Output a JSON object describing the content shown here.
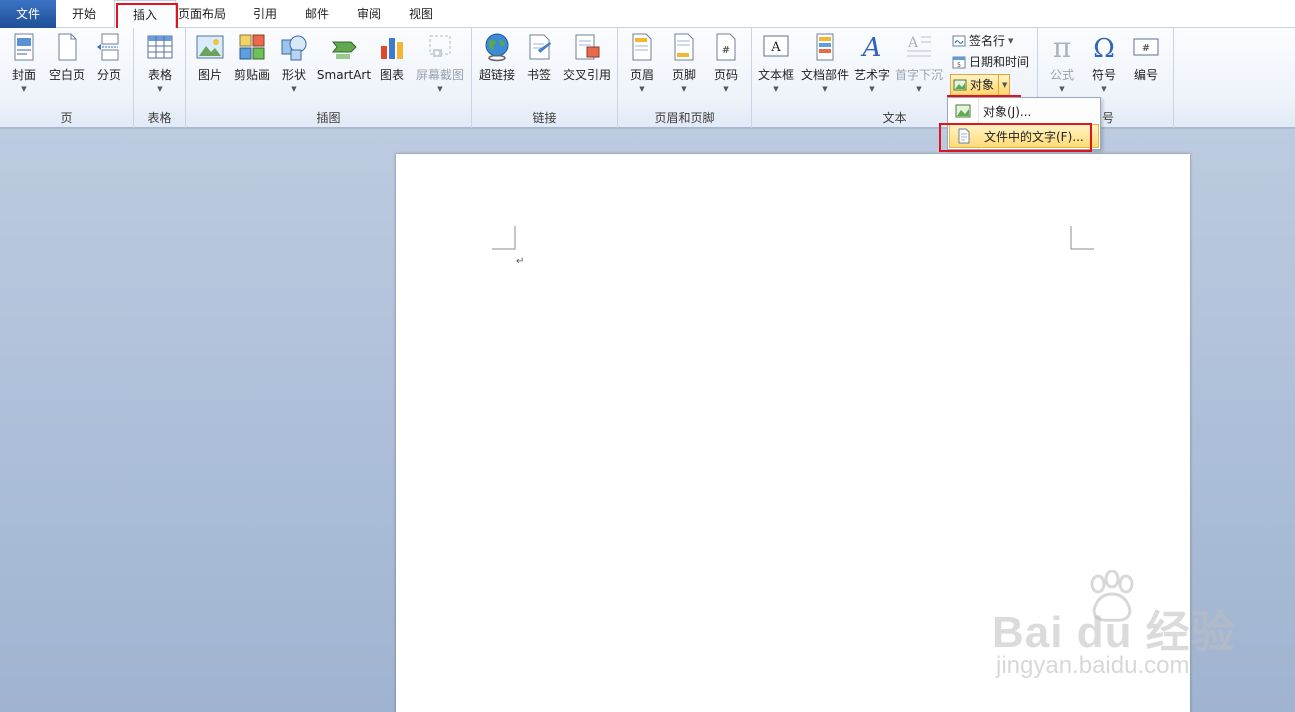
{
  "tabs": {
    "file": "文件",
    "home": "开始",
    "insert": "插入",
    "layout": "页面布局",
    "references": "引用",
    "mailings": "邮件",
    "review": "审阅",
    "view": "视图"
  },
  "groups": {
    "pages": {
      "label": "页",
      "cover": "封面",
      "blank": "空白页",
      "break": "分页"
    },
    "tables": {
      "label": "表格",
      "table": "表格"
    },
    "illustrations": {
      "label": "插图",
      "picture": "图片",
      "clipart": "剪贴画",
      "shapes": "形状",
      "smartart": "SmartArt",
      "chart": "图表",
      "screenshot": "屏幕截图"
    },
    "links": {
      "label": "链接",
      "hyperlink": "超链接",
      "bookmark": "书签",
      "crossref": "交叉引用"
    },
    "headerfooter": {
      "label": "页眉和页脚",
      "header": "页眉",
      "footer": "页脚",
      "pagenum": "页码"
    },
    "text": {
      "label": "文本",
      "textbox": "文本框",
      "quickparts": "文档部件",
      "wordart": "艺术字",
      "dropcap": "首字下沉",
      "signature": "签名行",
      "datetime": "日期和时间",
      "object": "对象"
    },
    "symbols": {
      "label": "符号",
      "label_visible": "号",
      "equation": "公式",
      "symbol": "符号",
      "number": "编号"
    }
  },
  "object_menu": {
    "item1": "对象(J)...",
    "item2": "文件中的文字(F)..."
  },
  "document": {
    "paragraph_mark": "↵"
  },
  "watermark": {
    "brand": "Bai du 经验",
    "url": "jingyan.baidu.com"
  },
  "colors": {
    "file_tab": "#2a5da8",
    "highlight_red": "#e0141e",
    "menu_highlight": "#ffdb75"
  }
}
